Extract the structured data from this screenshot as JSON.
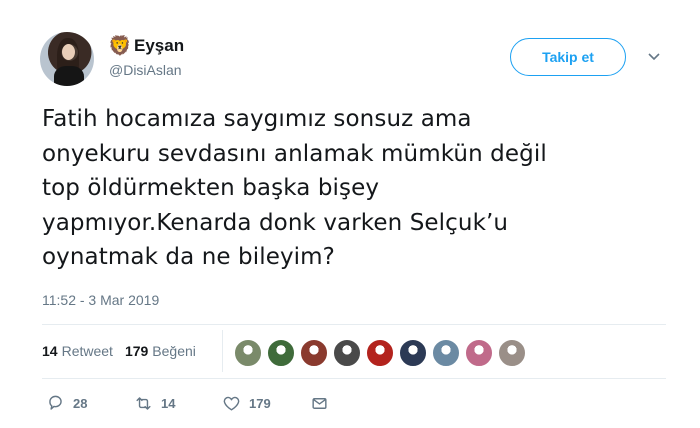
{
  "author": {
    "display_name": "Eyşan",
    "name_emoji": "🦁",
    "handle": "@DisiAslan"
  },
  "follow_button": {
    "label": "Takip et"
  },
  "tweet": {
    "lines": [
      "Fatih hocamıza saygımız sonsuz ama",
      "onyekuru sevdasını anlamak mümkün değil",
      "top öldürmekten başka bişey",
      "yapmıyor.Kenarda donk varken Selçuk’u",
      "oynatmak da ne bileyim?"
    ],
    "timestamp": "11:52 - 3 Mar 2019"
  },
  "stats": {
    "retweets": {
      "count": "14",
      "label": "Retweet"
    },
    "likes": {
      "count": "179",
      "label": "Beğeni"
    }
  },
  "liker_avatars": [
    {
      "color": "#7a8a6a"
    },
    {
      "color": "#3f6b3a"
    },
    {
      "color": "#8a3a2e"
    },
    {
      "color": "#4a4a4a"
    },
    {
      "color": "#b3231d"
    },
    {
      "color": "#2c3a55"
    },
    {
      "color": "#6b8aa3"
    },
    {
      "color": "#c06a8a"
    },
    {
      "color": "#9a8f88"
    }
  ],
  "actions": {
    "reply": {
      "icon": "reply-icon",
      "count": "28"
    },
    "retweet": {
      "icon": "retweet-icon",
      "count": "14"
    },
    "like": {
      "icon": "heart-icon",
      "count": "179"
    },
    "dm": {
      "icon": "envelope-icon"
    }
  },
  "colors": {
    "accent": "#1da1f2",
    "text": "#14171a",
    "secondary_text": "#657786",
    "divider": "#e6ecf0"
  }
}
